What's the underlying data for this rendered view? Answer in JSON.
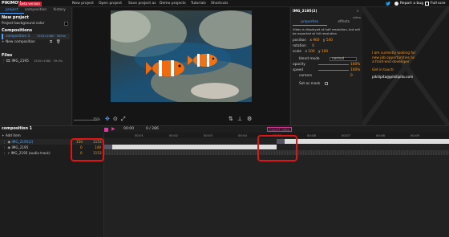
{
  "topbar": {
    "logo": "PIKIMOV",
    "beta": "beta version",
    "menu": [
      "New project",
      "Open project",
      "Save project as",
      "Demo projects",
      "Tutorials",
      "Shortcuts"
    ],
    "report_bug": "Report a bug",
    "fullscreen": "Full scre"
  },
  "left": {
    "tabs": [
      "project",
      "composition",
      "history"
    ],
    "new_project": "New project",
    "bg_color_label": "Project background color",
    "compositions_title": "Compositions",
    "composition_name": "composition 1",
    "composition_meta": "1920×1080 · 5000s",
    "new_composition": "New composition",
    "files_title": "Files",
    "file_name": "IMG_2195",
    "file_meta": "1920×1080 · 39.4%"
  },
  "preview": {
    "zoom": "25%"
  },
  "right": {
    "file_title": "IMG_2195(2)",
    "type": "video",
    "tabs": [
      "properties",
      "effects"
    ],
    "notice": "Video is displayed at half resolution, but will be exported at full resolution",
    "position_label": "position",
    "position_x": "960",
    "position_y": "540",
    "rotation_label": "rotation",
    "rotation_val": "0",
    "scale_label": "scale",
    "scale_x": "100",
    "scale_y": "100",
    "blend_label": "blend mode",
    "blend_val": "normal",
    "opacity_label": "opacity",
    "opacity_val": "100%",
    "speed_label": "speed",
    "speed_val": "100%",
    "corners_label": "corners",
    "corners_val": "0",
    "mask_label": "Set as mask"
  },
  "promo": {
    "line1": "I am currently looking for",
    "line2": "new job opportunities as",
    "line3": "a front-end developer",
    "contact_title": "Get in touch:",
    "email": "pikilipita@pikilipita.com"
  },
  "timeline": {
    "comp_name": "composition 1",
    "time": "00:00",
    "frames": "0 / 286",
    "export": "Export video",
    "add_item": "Add item",
    "ruler": [
      "00:01",
      "00:02",
      "00:03",
      "00:04",
      "00:05",
      "00:06",
      "00:07",
      "00:08",
      "00:09"
    ],
    "tracks": [
      {
        "name": "IMG_2195(2)",
        "start": "150",
        "end": "1153"
      },
      {
        "name": "IMG_2195",
        "start": "0",
        "end": "149"
      },
      {
        "name": "IMG_2195 (audio track)",
        "start": "0",
        "end": "1153"
      }
    ]
  }
}
